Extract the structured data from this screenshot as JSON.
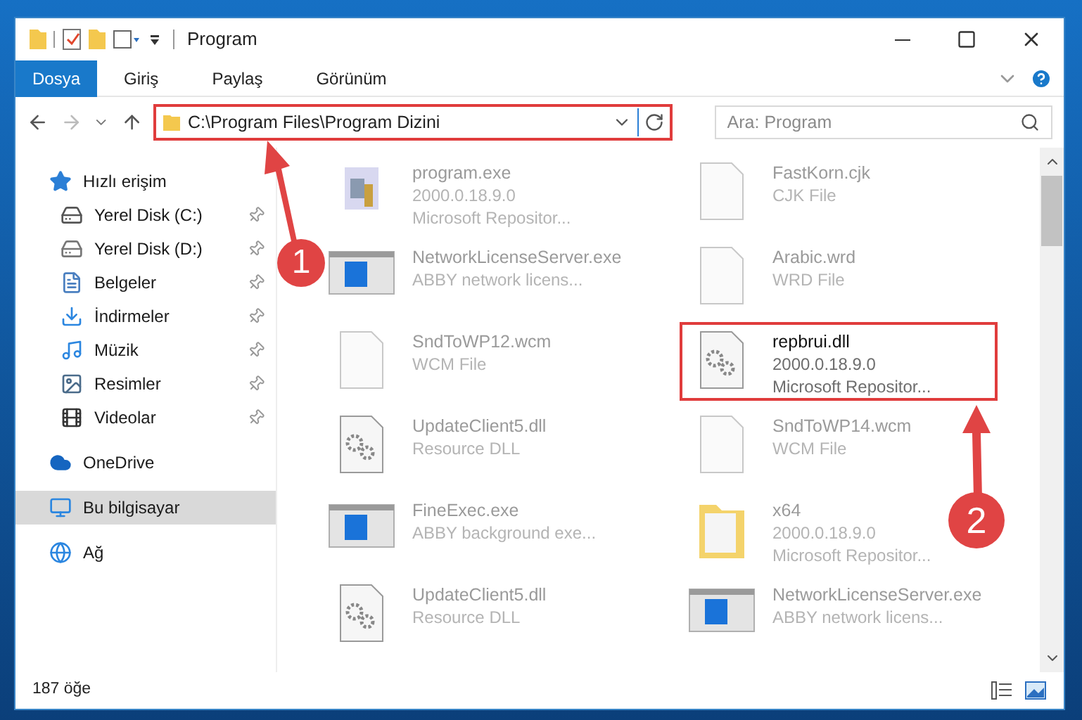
{
  "window": {
    "title": "Program"
  },
  "ribbon_tabs": [
    {
      "label": "Dosya",
      "selected": true
    },
    {
      "label": "Giriş",
      "selected": false
    },
    {
      "label": "Paylaş",
      "selected": false
    },
    {
      "label": "Görünüm",
      "selected": false
    }
  ],
  "address_bar": {
    "value": "C:\\Program Files\\Program Dizini",
    "highlighted": true
  },
  "search": {
    "placeholder": "Ara: Program"
  },
  "sidebar": {
    "items": [
      {
        "label": "Hızlı erişim",
        "kind": "star",
        "pinned": false,
        "selected": false,
        "children": [
          {
            "label": "Yerel Disk (C:)",
            "kind": "drive-c",
            "pinned": true,
            "selected": false
          },
          {
            "label": "Yerel Disk (D:)",
            "kind": "drive",
            "pinned": true,
            "selected": false
          },
          {
            "label": "Belgeler",
            "kind": "docs",
            "pinned": true,
            "selected": false
          },
          {
            "label": "İndirmeler",
            "kind": "download",
            "pinned": true,
            "selected": false
          },
          {
            "label": "Müzik",
            "kind": "music",
            "pinned": true,
            "selected": false
          },
          {
            "label": "Resimler",
            "kind": "pictures",
            "pinned": true,
            "selected": false
          },
          {
            "label": "Videolar",
            "kind": "video",
            "pinned": true,
            "selected": false
          }
        ]
      },
      {
        "label": "OneDrive",
        "kind": "cloud",
        "pinned": false,
        "selected": false
      },
      {
        "label": "Bu bilgisayar",
        "kind": "pc",
        "pinned": false,
        "selected": true
      },
      {
        "label": "Ağ",
        "kind": "network",
        "pinned": false,
        "selected": false
      }
    ]
  },
  "files": [
    {
      "name": "program.exe",
      "lines": [
        "2000.0.18.9.0",
        "Microsoft Repositor..."
      ],
      "kind": "app",
      "highlighted": false
    },
    {
      "name": "FastKorn.cjk",
      "lines": [
        "CJK File"
      ],
      "kind": "blank",
      "highlighted": false
    },
    {
      "name": "NetworkLicenseServer.exe",
      "lines": [
        "ABBY network licens..."
      ],
      "kind": "window",
      "highlighted": false
    },
    {
      "name": "Arabic.wrd",
      "lines": [
        "WRD File"
      ],
      "kind": "blank",
      "highlighted": false
    },
    {
      "name": "SndToWP12.wcm",
      "lines": [
        "WCM File"
      ],
      "kind": "blank",
      "highlighted": false
    },
    {
      "name": "repbrui.dll",
      "lines": [
        "2000.0.18.9.0",
        "Microsoft Repositor..."
      ],
      "kind": "dll",
      "highlighted": true
    },
    {
      "name": "UpdateClient5.dll",
      "lines": [
        "Resource DLL"
      ],
      "kind": "dll",
      "highlighted": false
    },
    {
      "name": "SndToWP14.wcm",
      "lines": [
        "WCM File"
      ],
      "kind": "blank",
      "highlighted": false
    },
    {
      "name": "FineExec.exe",
      "lines": [
        "ABBY background exe..."
      ],
      "kind": "window",
      "highlighted": false
    },
    {
      "name": "x64",
      "lines": [
        "2000.0.18.9.0",
        "Microsoft Repositor..."
      ],
      "kind": "folder",
      "highlighted": false
    },
    {
      "name": "UpdateClient5.dll",
      "lines": [
        "Resource DLL"
      ],
      "kind": "dll",
      "highlighted": false
    },
    {
      "name": "NetworkLicenseServer.exe",
      "lines": [
        "ABBY network licens..."
      ],
      "kind": "window",
      "highlighted": false
    }
  ],
  "status_bar": {
    "count": "187 öğe"
  },
  "annotations": [
    {
      "number": "1"
    },
    {
      "number": "2"
    }
  ]
}
